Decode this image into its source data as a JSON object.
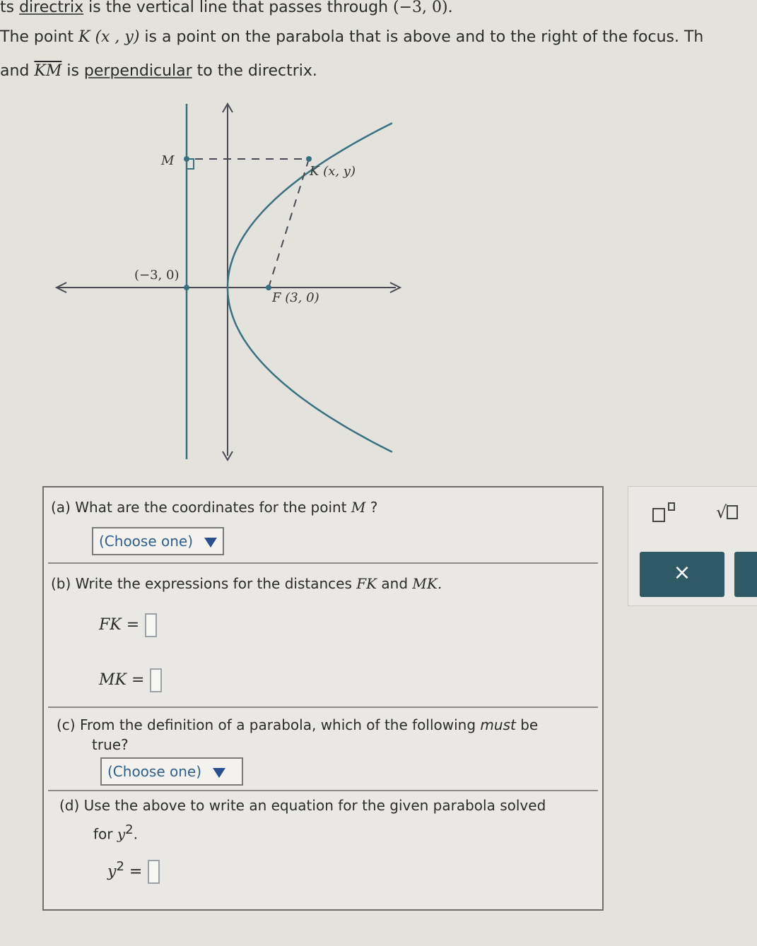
{
  "intro": {
    "line1": {
      "pre": "ts ",
      "link": "directrix",
      "post": " is the vertical line that passes through ",
      "math": "(−3, 0)."
    },
    "line2": {
      "pre": "The point ",
      "math": "K (x , y)",
      "post": " is a point on the parabola that is above and to the right of the focus. Th"
    },
    "line3": {
      "pre": "and ",
      "segment": "KM",
      "mid": " is ",
      "link": "perpendicular",
      "post": " to the directrix."
    }
  },
  "graph": {
    "label_M": "M",
    "label_K": "K (x, y)",
    "label_directrix_point": "(−3, 0)",
    "label_F": "F (3, 0)",
    "curve_color": "#3a7080"
  },
  "parts": {
    "a": {
      "label": "(a)",
      "text": "What are the coordinates for the point",
      "var": "M",
      "end": " ?",
      "dropdown": "(Choose one)"
    },
    "b": {
      "label": "(b)",
      "text": "Write the expressions for the distances",
      "var1": "FK",
      "and": "and",
      "var2": "MK.",
      "fk": "FK =",
      "mk": "MK ="
    },
    "c": {
      "label": "(c)",
      "text1": "From the definition of a parabola, which of the following",
      "must": "must",
      "be": "be",
      "text2": "true?",
      "dropdown": "(Choose one)"
    },
    "d": {
      "label": "(d)",
      "text1": "Use the above to write an equation for the given parabola solved",
      "for": "for",
      "y2": "y",
      "exp": "2",
      "dot": ".",
      "eq_y": "y",
      "eq_exp": "2",
      "eq": "="
    }
  },
  "toolbar": {
    "sqrt_symbol": "√",
    "x_button": "×",
    "accent": "#2f5965"
  }
}
